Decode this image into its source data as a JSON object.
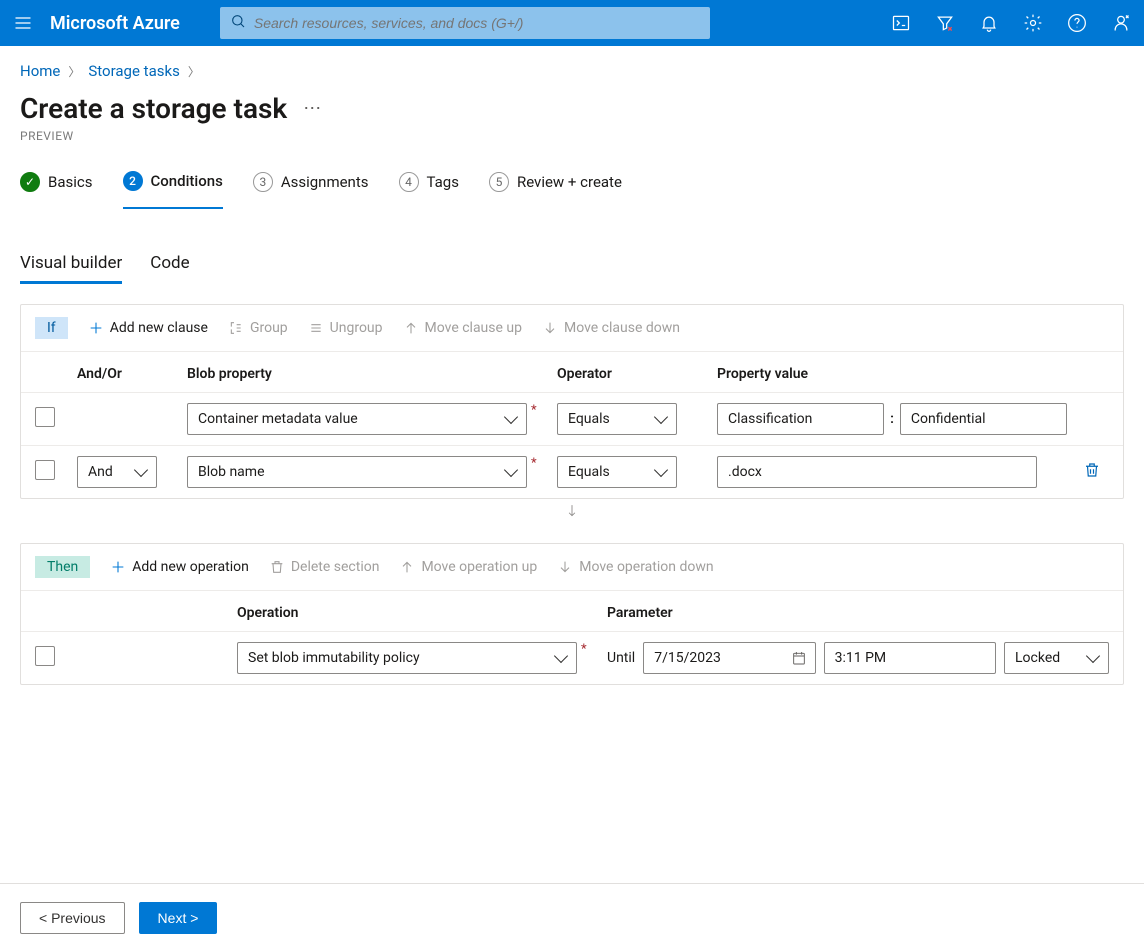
{
  "topbar": {
    "brand": "Microsoft Azure",
    "search_placeholder": "Search resources, services, and docs (G+/)"
  },
  "breadcrumb": {
    "items": [
      "Home",
      "Storage tasks"
    ]
  },
  "page": {
    "title": "Create a storage task",
    "subtitle": "PREVIEW"
  },
  "steps": [
    {
      "label": "Basics",
      "state": "done"
    },
    {
      "label": "Conditions",
      "state": "active",
      "num": "2"
    },
    {
      "label": "Assignments",
      "state": "pending",
      "num": "3"
    },
    {
      "label": "Tags",
      "state": "pending",
      "num": "4"
    },
    {
      "label": "Review + create",
      "state": "pending",
      "num": "5"
    }
  ],
  "subtabs": {
    "items": [
      "Visual builder",
      "Code"
    ],
    "active": 0
  },
  "if_section": {
    "pill": "If",
    "toolbar": {
      "add": "Add new clause",
      "group": "Group",
      "ungroup": "Ungroup",
      "up": "Move clause up",
      "down": "Move clause down"
    },
    "headers": {
      "andor": "And/Or",
      "property": "Blob property",
      "operator": "Operator",
      "value": "Property value"
    },
    "rows": [
      {
        "andor": "",
        "property": "Container metadata value",
        "operator": "Equals",
        "value_key": "Classification",
        "value_val": "Confidential"
      },
      {
        "andor": "And",
        "property": "Blob name",
        "operator": "Equals",
        "value": ".docx"
      }
    ]
  },
  "then_section": {
    "pill": "Then",
    "toolbar": {
      "add": "Add new operation",
      "delete": "Delete section",
      "up": "Move operation up",
      "down": "Move operation down"
    },
    "headers": {
      "operation": "Operation",
      "parameter": "Parameter"
    },
    "rows": [
      {
        "operation": "Set blob immutability policy",
        "param_label": "Until",
        "date": "7/15/2023",
        "time": "3:11 PM",
        "mode": "Locked"
      }
    ]
  },
  "nav": {
    "prev": "< Previous",
    "next": "Next >"
  }
}
